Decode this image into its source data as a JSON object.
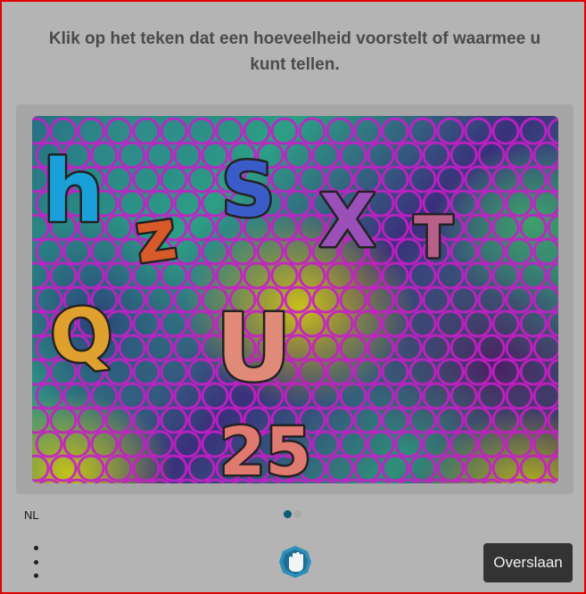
{
  "prompt": {
    "line1": "Klik op het teken dat een hoeveelheid voorstelt of waarmee u",
    "line2": "kunt tellen."
  },
  "challenge": {
    "glyphs": [
      {
        "id": "h",
        "text": "h",
        "fill": "#1aa0d8"
      },
      {
        "id": "z",
        "text": "z",
        "fill": "#d85a2a"
      },
      {
        "id": "s",
        "text": "S",
        "fill": "#3a5cc8"
      },
      {
        "id": "x",
        "text": "X",
        "fill": "#9b4fb8"
      },
      {
        "id": "t",
        "text": "T",
        "fill": "#b8608a"
      },
      {
        "id": "q",
        "text": "Q",
        "fill": "#e0a030"
      },
      {
        "id": "u",
        "text": "U",
        "fill": "#e08a7a"
      },
      {
        "id": "25",
        "text": "25",
        "fill": "#e07a70"
      }
    ],
    "ring_color": "#c81ec8"
  },
  "footer": {
    "language": "NL",
    "skip_label": "Overslaan",
    "menu_icon": "vertical-dots-icon",
    "logo_icon": "hand-logo-icon"
  },
  "pagination": {
    "current": 1,
    "total": 2
  },
  "colors": {
    "frame_border": "#e10000",
    "overlay": "#b4b4b4",
    "button_bg": "#333333",
    "dot_active": "#0d5b74"
  }
}
